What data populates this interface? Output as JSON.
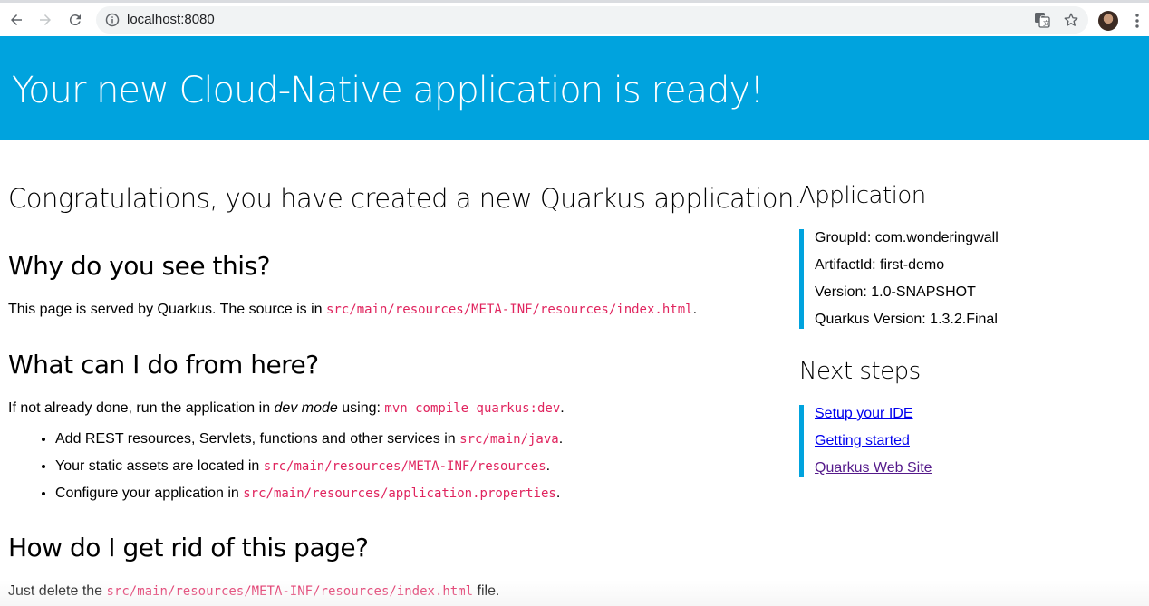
{
  "browser": {
    "url": "localhost:8080"
  },
  "banner": {
    "title": "Your new Cloud-Native application is ready!",
    "color": "#00a3de"
  },
  "main": {
    "congrats": "Congratulations, you have created a new Quarkus application.",
    "why": {
      "heading": "Why do you see this?",
      "text_before": "This page is served by Quarkus. The source is in ",
      "code": "src/main/resources/META-INF/resources/index.html",
      "text_after": "."
    },
    "what": {
      "heading": "What can I do from here?",
      "text_before": "If not already done, run the application in ",
      "em": "dev mode",
      "text_mid": " using: ",
      "code": "mvn compile quarkus:dev",
      "text_after": ".",
      "bullets": [
        {
          "text": "Add REST resources, Servlets, functions and other services in ",
          "code": "src/main/java",
          "after": "."
        },
        {
          "text": "Your static assets are located in ",
          "code": "src/main/resources/META-INF/resources",
          "after": "."
        },
        {
          "text": "Configure your application in ",
          "code": "src/main/resources/application.properties",
          "after": "."
        }
      ]
    },
    "rid": {
      "heading": "How do I get rid of this page?",
      "text_before": "Just delete the ",
      "code": "src/main/resources/META-INF/resources/index.html",
      "text_after": " file."
    }
  },
  "sidebar": {
    "application": {
      "heading": "Application",
      "items": [
        "GroupId: com.wonderingwall",
        "ArtifactId: first-demo",
        "Version: 1.0-SNAPSHOT",
        "Quarkus Version: 1.3.2.Final"
      ]
    },
    "next_steps": {
      "heading": "Next steps",
      "links": [
        "Setup your IDE",
        "Getting started",
        "Quarkus Web Site"
      ]
    }
  },
  "colors": {
    "accent": "#00a3de",
    "code": "#e0245e",
    "link": "#0000ee",
    "link_visited": "#551a8b"
  }
}
